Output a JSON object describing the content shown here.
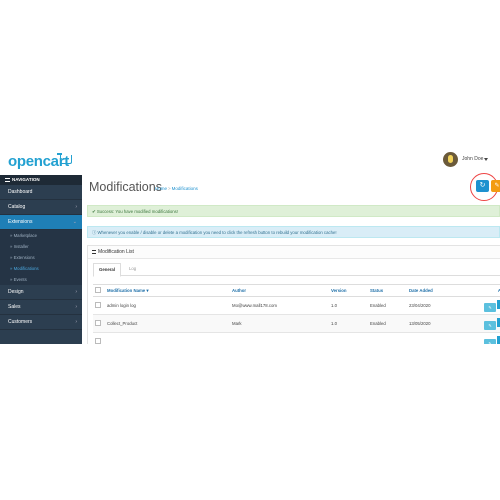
{
  "header": {
    "logo": "opencart",
    "user": "John Doe"
  },
  "sidebar": {
    "heading": "NAVIGATION",
    "items": [
      {
        "label": "Dashboard"
      },
      {
        "label": "Catalog"
      },
      {
        "label": "Extensions"
      },
      {
        "label": "Marketplace"
      },
      {
        "label": "Installer"
      },
      {
        "label": "Extensions"
      },
      {
        "label": "Modifications"
      },
      {
        "label": "Events"
      },
      {
        "label": "Design"
      },
      {
        "label": "Sales"
      },
      {
        "label": "Customers"
      }
    ]
  },
  "page": {
    "title": "Modifications",
    "breadcrumb": [
      "Home",
      "Modifications"
    ],
    "refresh_icon": "refresh-icon",
    "success": "Success: You have modified modifications!",
    "info": "Whenever you enable / disable or delete a modification you need to click the refresh button to rebuild your modification cache!"
  },
  "panel": {
    "title": "Modification List",
    "tabs": [
      "General",
      "Log"
    ],
    "columns": [
      "Modification Name",
      "Author",
      "Version",
      "Status",
      "Date Added",
      "A"
    ],
    "sort_indicator": "▾",
    "rows": [
      {
        "name": "admin login log",
        "author": "Mo@www.mall178.com",
        "version": "1.0",
        "status": "Enabled",
        "date": "23/04/2020"
      },
      {
        "name": "Collect_Product",
        "author": "Mark",
        "version": "1.0",
        "status": "Enabled",
        "date": "13/05/2020"
      }
    ]
  },
  "colors": {
    "accent": "#1e91cf",
    "sidebar": "#2c3e50",
    "active": "#1f7fb6",
    "warning": "#f39c12"
  }
}
